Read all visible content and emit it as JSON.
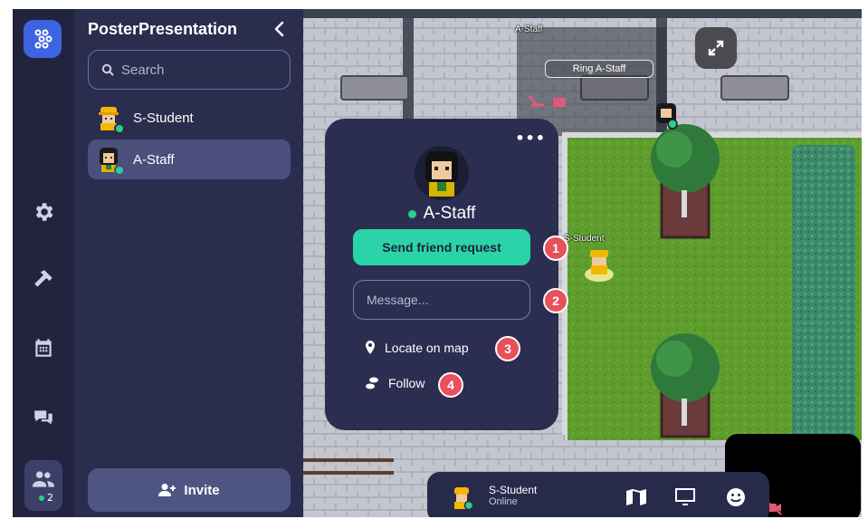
{
  "sidebar": {
    "title": "PosterPresentation",
    "search_placeholder": "Search",
    "people": [
      {
        "name": "S-Student",
        "status": "online"
      },
      {
        "name": "A-Staff",
        "status": "online"
      }
    ],
    "invite_label": "Invite"
  },
  "rail": {
    "icons": [
      "app-logo-icon",
      "gear-icon",
      "hammer-icon",
      "calendar-icon",
      "chat-icon",
      "people-icon"
    ],
    "online_count": "2"
  },
  "profile_card": {
    "name": "A-Staff",
    "more_label": "•••",
    "friend_request_label": "Send friend request",
    "message_placeholder": "Message...",
    "locate_label": "Locate on map",
    "follow_label": "Follow",
    "badges": [
      "1",
      "2",
      "3",
      "4"
    ]
  },
  "map": {
    "room_label": "A-Staff",
    "ring_label": "Ring A-Staff",
    "player_label": "S-Student"
  },
  "bottom_bar": {
    "name": "S-Student",
    "status": "Online",
    "icons": [
      "map-icon",
      "screen-share-icon",
      "emoji-icon"
    ]
  },
  "colors": {
    "accent_green": "#2bd4a8",
    "status_online": "#2ecc8f",
    "badge_red": "#e8505a",
    "panel": "#2a2d4e"
  }
}
